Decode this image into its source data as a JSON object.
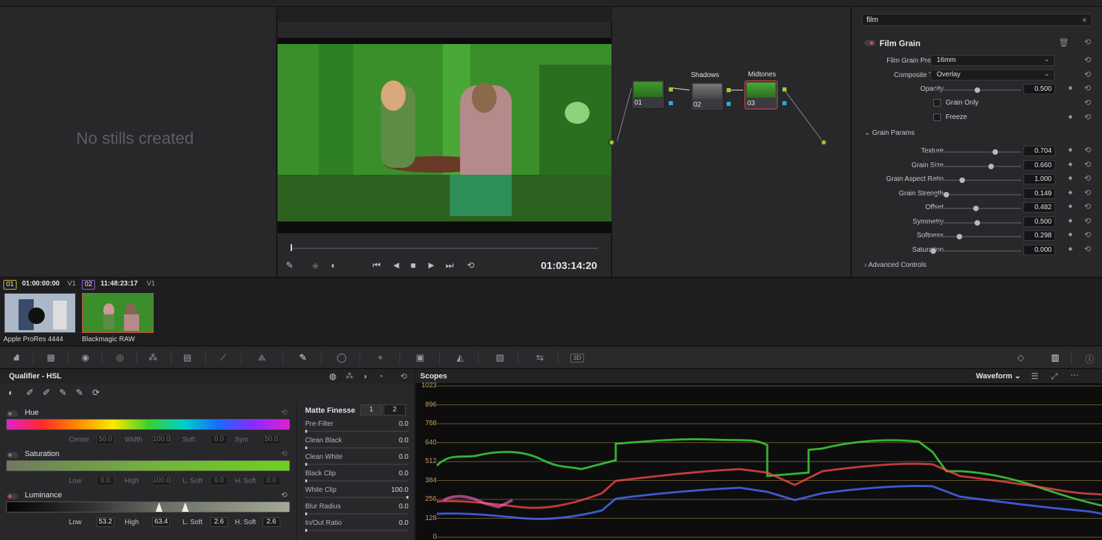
{
  "gallery": {
    "empty_text": "No stills created"
  },
  "viewer": {
    "timecode": "01:03:14:20",
    "transport": {
      "skip_back": "⏮",
      "step_back": "◀",
      "stop": "■",
      "play": "▶",
      "skip_fwd": "⏭",
      "loop": "⟲"
    }
  },
  "nodes": {
    "items": [
      {
        "number": "01",
        "title": ""
      },
      {
        "number": "02",
        "title": "Shadows"
      },
      {
        "number": "03",
        "title": "Midtones"
      }
    ]
  },
  "inspector": {
    "search_value": "film",
    "plugin_title": "Film Grain",
    "film_grain_presets": {
      "label": "Film Grain Presets",
      "value": "16mm"
    },
    "composite_type": {
      "label": "Composite Type",
      "value": "Overlay"
    },
    "opacity": {
      "label": "Opacity",
      "value": "0.500",
      "fraction": 0.5
    },
    "grain_only": {
      "label": "Grain Only"
    },
    "freeze": {
      "label": "Freeze"
    },
    "grain_params_title": "Grain Params",
    "params": [
      {
        "label": "Texture",
        "value": "0.704",
        "fraction": 0.704
      },
      {
        "label": "Grain Size",
        "value": "0.660",
        "fraction": 0.66
      },
      {
        "label": "Grain Aspect Ratio",
        "value": "1.000",
        "fraction": 0.33
      },
      {
        "label": "Grain Strength",
        "value": "0.149",
        "fraction": 0.149
      },
      {
        "label": "Offset",
        "value": "0.482",
        "fraction": 0.482
      },
      {
        "label": "Symmetry",
        "value": "0.500",
        "fraction": 0.5
      },
      {
        "label": "Softness",
        "value": "0.298",
        "fraction": 0.298
      },
      {
        "label": "Saturation",
        "value": "0.000",
        "fraction": 0.0
      }
    ],
    "advanced_title": "Advanced Controls"
  },
  "clips": [
    {
      "number": "01",
      "timecode": "01:00:00:00",
      "track": "V1",
      "name": "Apple ProRes 4444",
      "color": "#d6b83a"
    },
    {
      "number": "02",
      "timecode": "11:48:23:17",
      "track": "V1",
      "name": "Blackmagic RAW",
      "color": "#9b5fd6"
    }
  ],
  "qualifier": {
    "title": "Qualifier - HSL",
    "hue": {
      "label": "Hue",
      "fields": [
        {
          "name": "Center",
          "value": "50.0"
        },
        {
          "name": "Width",
          "value": "100.0"
        },
        {
          "name": "Soft",
          "value": "0.0"
        },
        {
          "name": "Sym",
          "value": "50.0"
        }
      ]
    },
    "saturation": {
      "label": "Saturation",
      "fields": [
        {
          "name": "Low",
          "value": "0.0"
        },
        {
          "name": "High",
          "value": "100.0"
        },
        {
          "name": "L. Soft",
          "value": "0.0"
        },
        {
          "name": "H. Soft",
          "value": "0.0"
        }
      ]
    },
    "luminance": {
      "label": "Luminance",
      "fields": [
        {
          "name": "Low",
          "value": "53.2"
        },
        {
          "name": "High",
          "value": "63.4"
        },
        {
          "name": "L. Soft",
          "value": "2.6"
        },
        {
          "name": "H. Soft",
          "value": "2.6"
        }
      ]
    },
    "matte_finesse": {
      "title": "Matte Finesse",
      "tabs": [
        "1",
        "2"
      ],
      "rows": [
        {
          "name": "Pre-Filter",
          "value": "0.0"
        },
        {
          "name": "Clean Black",
          "value": "0.0"
        },
        {
          "name": "Clean White",
          "value": "0.0"
        },
        {
          "name": "Black Clip",
          "value": "0.0"
        },
        {
          "name": "White Clip",
          "value": "100.0"
        },
        {
          "name": "Blur Radius",
          "value": "0.0"
        },
        {
          "name": "In/Out Ratio",
          "value": "0.0"
        }
      ]
    }
  },
  "scopes": {
    "title": "Scopes",
    "mode": "Waveform",
    "ticks": [
      "1023",
      "896",
      "768",
      "640",
      "512",
      "384",
      "256",
      "128",
      "0"
    ]
  },
  "colors": {
    "accent_red": "#e04848",
    "node_pin_green": "#9ccb2a",
    "node_pin_blue": "#2ea8e0",
    "scope_tick": "#c7a253"
  }
}
